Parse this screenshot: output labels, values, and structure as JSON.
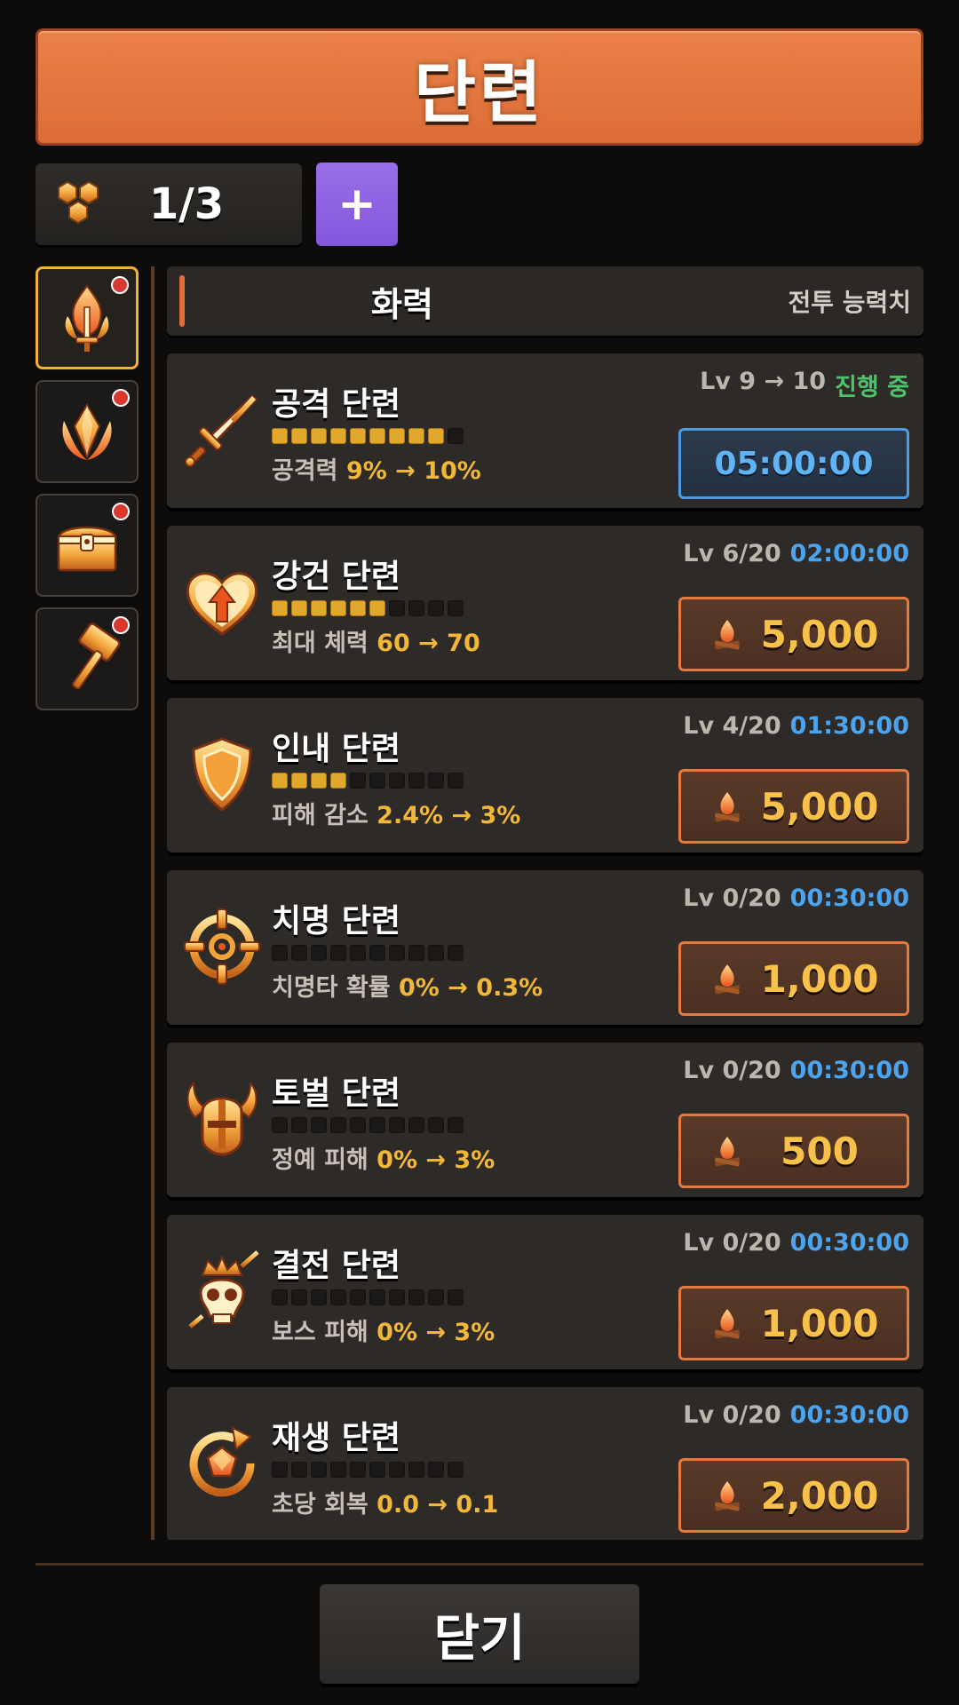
{
  "header": {
    "title": "단련"
  },
  "counter": {
    "value": "1/3",
    "icon": "honeycomb-icon",
    "add_label": "+"
  },
  "sidebar": {
    "tabs": [
      {
        "icon": "flame-sword-icon",
        "active": true,
        "badge": true
      },
      {
        "icon": "fire-crystal-icon",
        "active": false,
        "badge": true
      },
      {
        "icon": "treasure-chest-icon",
        "active": false,
        "badge": true
      },
      {
        "icon": "hammer-icon",
        "active": false,
        "badge": true
      }
    ]
  },
  "category": {
    "title": "화력",
    "subtitle": "전투 능력치"
  },
  "upgrades": [
    {
      "name": "공격 단련",
      "icon": "sword-icon",
      "level": "Lv 9 → 10",
      "status": "진행 중",
      "pips_filled": 9,
      "pips_total": 10,
      "stat_label": "공격력",
      "stat_value": "9% → 10%",
      "timer": "05:00:00"
    },
    {
      "name": "강건 단련",
      "icon": "heart-up-icon",
      "level": "Lv 6/20",
      "time": "02:00:00",
      "pips_filled": 6,
      "pips_total": 10,
      "stat_label": "최대 체력",
      "stat_value": "60 → 70",
      "cost": "5,000"
    },
    {
      "name": "인내 단련",
      "icon": "shield-icon",
      "level": "Lv 4/20",
      "time": "01:30:00",
      "pips_filled": 4,
      "pips_total": 10,
      "stat_label": "피해 감소",
      "stat_value": "2.4% → 3%",
      "cost": "5,000"
    },
    {
      "name": "치명 단련",
      "icon": "crosshair-icon",
      "level": "Lv 0/20",
      "time": "00:30:00",
      "pips_filled": 0,
      "pips_total": 10,
      "stat_label": "치명타 확률",
      "stat_value": "0% → 0.3%",
      "cost": "1,000"
    },
    {
      "name": "토벌 단련",
      "icon": "horned-helmet-icon",
      "level": "Lv 0/20",
      "time": "00:30:00",
      "pips_filled": 0,
      "pips_total": 10,
      "stat_label": "정예 피해",
      "stat_value": "0% → 3%",
      "cost": "500"
    },
    {
      "name": "결전 단련",
      "icon": "crowned-skull-icon",
      "level": "Lv 0/20",
      "time": "00:30:00",
      "pips_filled": 0,
      "pips_total": 10,
      "stat_label": "보스 피해",
      "stat_value": "0% → 3%",
      "cost": "1,000"
    },
    {
      "name": "재생 단련",
      "icon": "regen-gem-icon",
      "level": "Lv 0/20",
      "time": "00:30:00",
      "pips_filled": 0,
      "pips_total": 10,
      "stat_label": "초당 회복",
      "stat_value": "0.0 → 0.1",
      "cost": "2,000"
    }
  ],
  "footer": {
    "close_label": "닫기"
  },
  "colors": {
    "accent": "#e0733e",
    "gold": "#f0b73a",
    "timer_blue": "#4da4ee",
    "progress_green": "#4cc36a",
    "badge_red": "#d83a32",
    "plus_purple": "#8a5fe0"
  }
}
